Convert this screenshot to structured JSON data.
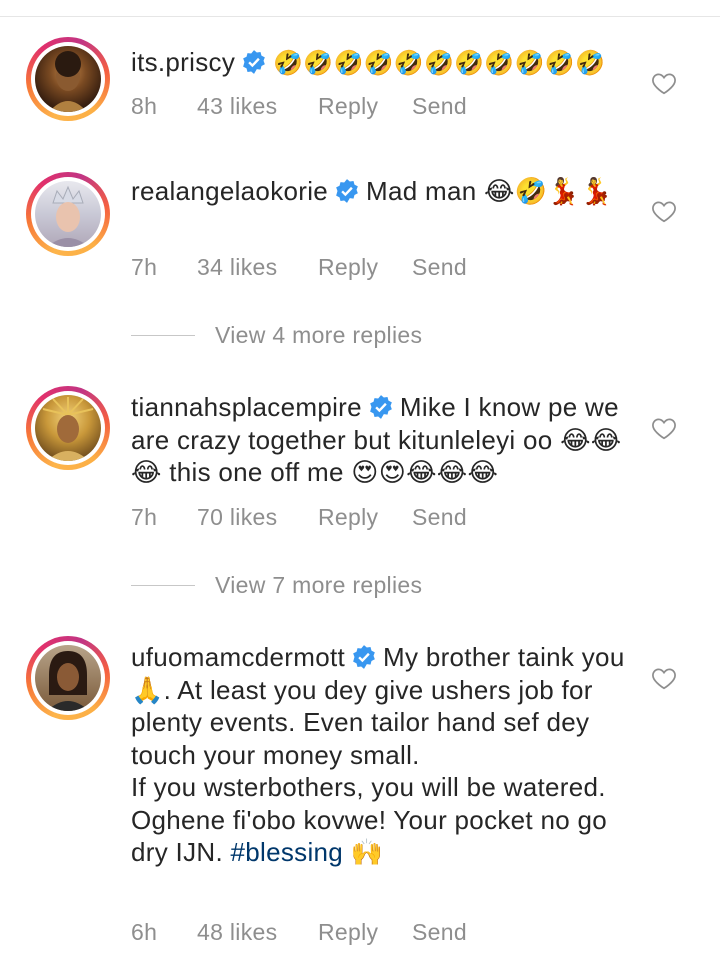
{
  "comments": [
    {
      "username": "its.priscy",
      "text": "🤣🤣🤣🤣🤣🤣🤣🤣🤣🤣🤣",
      "time": "8h",
      "likes": "43 likes",
      "reply_label": "Reply",
      "send_label": "Send"
    },
    {
      "username": "realangelaokorie",
      "text": "Mad man 😂🤣💃💃",
      "time": "7h",
      "likes": "34 likes",
      "reply_label": "Reply",
      "send_label": "Send",
      "view_replies": "View 4 more replies"
    },
    {
      "username": "tiannahsplacempire",
      "text": "Mike I know pe we are crazy together but kitunleleyi oo 😂😂😂 this one off me 😍😍😂😂😂",
      "time": "7h",
      "likes": "70 likes",
      "reply_label": "Reply",
      "send_label": "Send",
      "view_replies": "View 7 more replies"
    },
    {
      "username": "ufuomamcdermott",
      "text_part1": "My brother taink you 🙏. At least you dey give ushers job for plenty events. Even tailor hand sef dey touch your money small.",
      "text_part2": "If you wsterbothers, you will be watered.",
      "text_part3": "Oghene fi'obo kovwe! Your pocket no go dry IJN. ",
      "hashtag": "#blessing",
      "text_part4": " 🙌",
      "time": "6h",
      "likes": "48 likes",
      "reply_label": "Reply",
      "send_label": "Send"
    }
  ],
  "colors": {
    "text": "#262626",
    "meta": "#8e8e8e",
    "verified": "#3897f0",
    "hashtag": "#00376b"
  }
}
